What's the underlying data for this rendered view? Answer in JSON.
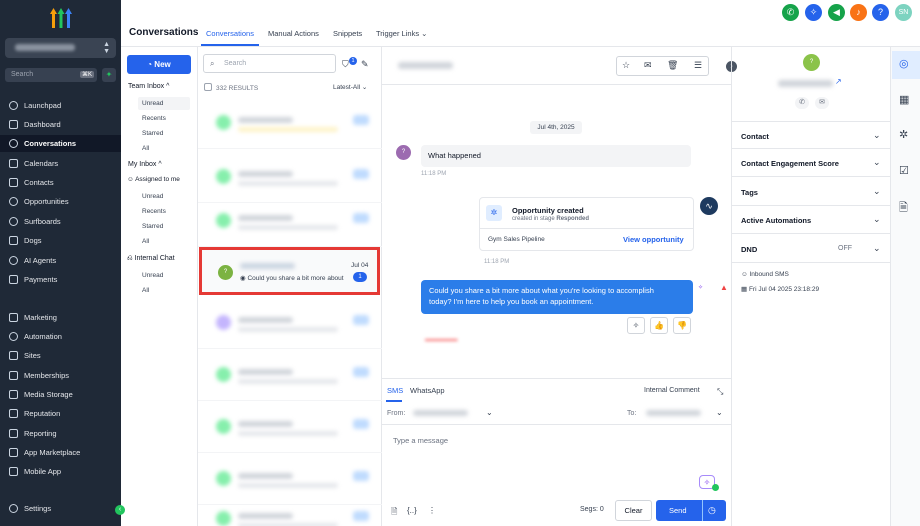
{
  "nav": {
    "search_placeholder": "Search",
    "search_kbd": "⌘K",
    "items": [
      "Launchpad",
      "Dashboard",
      "Conversations",
      "Calendars",
      "Contacts",
      "Opportunities",
      "Surfboards",
      "Dogs",
      "AI Agents",
      "Payments"
    ],
    "items2": [
      "Marketing",
      "Automation",
      "Sites",
      "Memberships",
      "Media Storage",
      "Reputation",
      "Reporting",
      "App Marketplace",
      "Mobile App"
    ],
    "settings": "Settings"
  },
  "header": {
    "title": "Conversations",
    "tabs": [
      "Conversations",
      "Manual Actions",
      "Snippets",
      "Trigger Links"
    ],
    "avatar": "SN"
  },
  "sub": {
    "new_label": "New",
    "team_inbox": "Team Inbox",
    "team_items": [
      "Unread",
      "Recents",
      "Starred",
      "All"
    ],
    "my_inbox": "My Inbox",
    "assigned": "Assigned to me",
    "my_items": [
      "Unread",
      "Recents",
      "Starred",
      "All"
    ],
    "internal_chat": "Internal Chat",
    "chat_items": [
      "Unread",
      "All"
    ]
  },
  "list": {
    "search_placeholder": "Search",
    "filter_badge": "1",
    "results": "332 RESULTS",
    "sort": "Latest-All",
    "selected": {
      "avatar": "?",
      "preview": "Could you share a bit more about",
      "date": "Jul 04",
      "count": "1"
    }
  },
  "chat": {
    "date_pill": "Jul 4th, 2025",
    "incoming_avatar": "?",
    "incoming_text": "What happened",
    "time1": "11:18 PM",
    "opp_title": "Opportunity created",
    "opp_sub_prefix": "created in stage",
    "opp_stage": "Responded",
    "opp_pipeline": "Gym Sales Pipeline",
    "opp_link": "View opportunity",
    "time2": "11:18 PM",
    "outgoing_text_1": "Could you share a bit more about what you're looking to accomplish",
    "outgoing_text_2": "today? I'm here to help you book an appointment."
  },
  "composer": {
    "tabs": [
      "SMS",
      "WhatsApp"
    ],
    "internal_comment": "Internal Comment",
    "from_label": "From:",
    "to_label": "To:",
    "placeholder": "Type a message",
    "segs": "Segs: 0",
    "clear": "Clear",
    "send": "Send"
  },
  "contact": {
    "avatar": "?",
    "sections": [
      {
        "title": "Contact",
        "value": ""
      },
      {
        "title": "Contact Engagement Score",
        "value": ""
      },
      {
        "title": "Tags",
        "value": ""
      },
      {
        "title": "Active Automations",
        "value": ""
      },
      {
        "title": "DND",
        "value": "OFF"
      }
    ],
    "source": "Inbound SMS",
    "created": "Fri Jul 04 2025 23:18:29"
  },
  "colors": {
    "accent": "#2563eb",
    "nav_bg": "#1f2937",
    "highlight": "#e53935"
  }
}
